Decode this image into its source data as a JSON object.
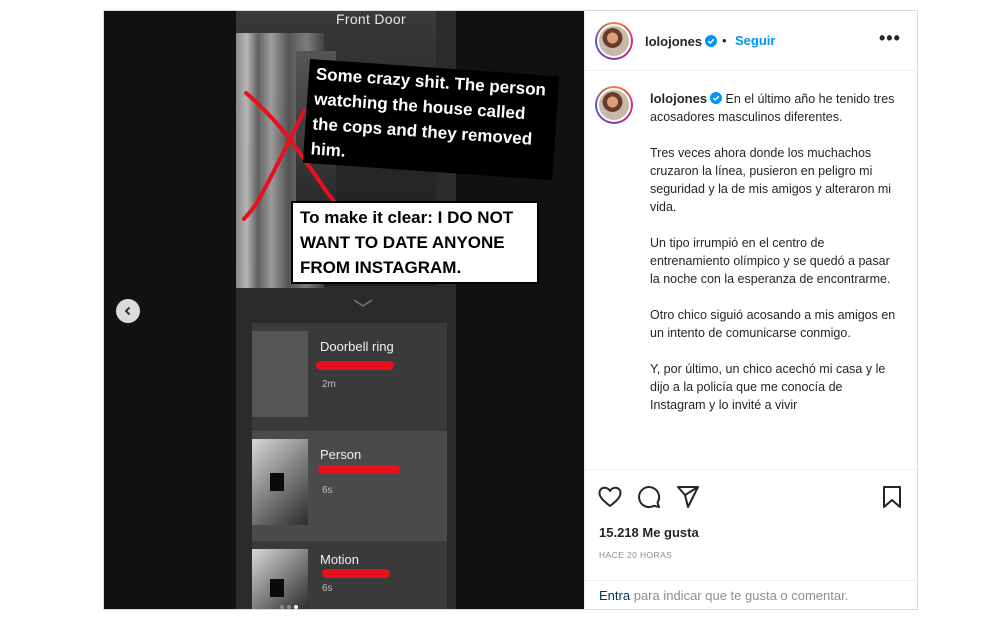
{
  "media": {
    "front_door_label": "Front Door",
    "caption_1": "Some crazy shit. The person watching the house called the cops and they removed him.",
    "caption_2": "To make it clear: I DO NOT WANT TO DATE ANYONE FROM INSTAGRAM.",
    "events": [
      {
        "title": "Doorbell ring",
        "time": "2m"
      },
      {
        "title": "Person",
        "time": "6s"
      },
      {
        "title": "Motion",
        "time": "6s"
      }
    ],
    "scribble_color": "#e8101e"
  },
  "header": {
    "username": "lolojones",
    "separator": "•",
    "follow_label": "Seguir",
    "more_label": "•••",
    "accent": "#0095f6"
  },
  "caption": {
    "username": "lolojones",
    "paragraphs": [
      "En el último año he tenido tres acosadores masculinos diferentes.",
      "Tres veces ahora donde los muchachos cruzaron la línea, pusieron en peligro mi seguridad y la de mis amigos y alteraron mi vida.",
      "Un tipo irrumpió en el centro de entrenamiento olímpico y se quedó a pasar la noche con la esperanza de encontrarme.",
      "Otro chico siguió acosando a mis amigos en un intento de comunicarse conmigo.",
      "Y, por último, un chico acechó mi casa y le dijo a la policía que me conocía de Instagram y lo invité a vivir"
    ]
  },
  "actions": {
    "icons": [
      "heart-icon",
      "comment-icon",
      "share-icon",
      "bookmark-icon"
    ],
    "likes": "15.218 Me gusta",
    "time_ago": "HACE 20 HORAS",
    "comment_link": "Entra",
    "comment_placeholder": "para indicar que te gusta o comentar."
  }
}
